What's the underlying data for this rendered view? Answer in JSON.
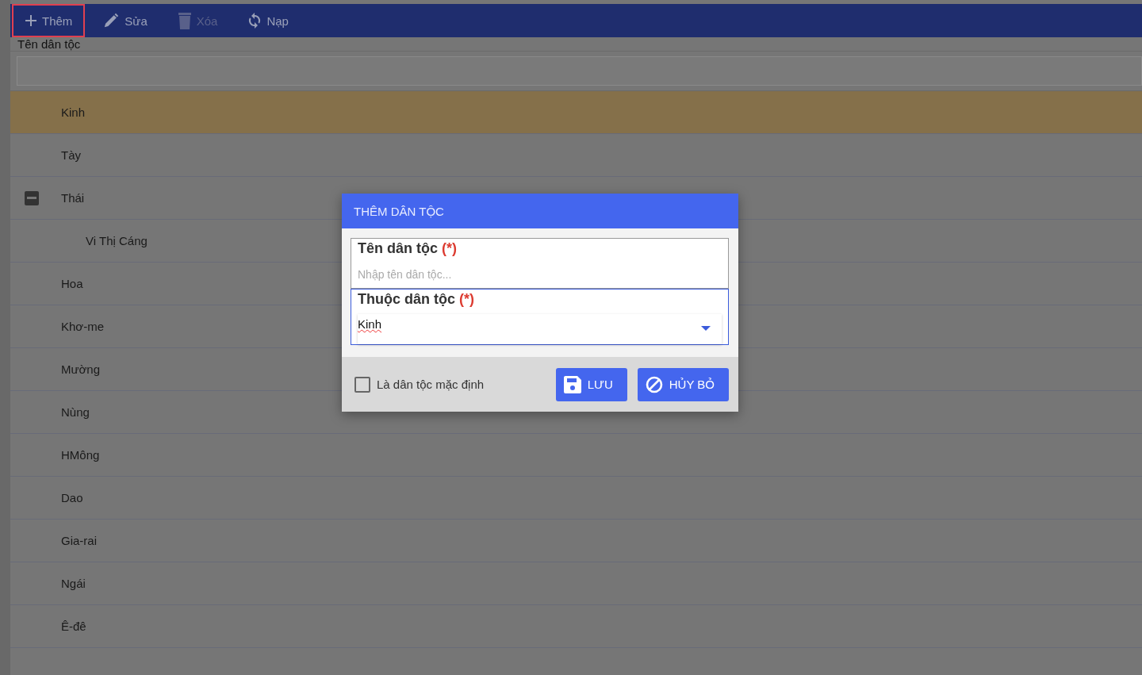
{
  "toolbar": [
    {
      "kind": "add",
      "label": "Thêm",
      "focused": true,
      "disabled": false
    },
    {
      "kind": "edit",
      "label": "Sửa",
      "focused": false,
      "disabled": false
    },
    {
      "kind": "delete",
      "label": "Xóa",
      "focused": false,
      "disabled": true
    },
    {
      "kind": "reload",
      "label": "Nạp",
      "focused": false,
      "disabled": false
    }
  ],
  "column_header": "Tên dân tộc",
  "rows": [
    {
      "name": "Kinh",
      "selected": true
    },
    {
      "name": "Tày",
      "selected": false
    },
    {
      "name": "Thái",
      "selected": false,
      "expanded": true,
      "children": [
        {
          "name": "Vi Thị Cáng",
          "selected": false
        }
      ]
    },
    {
      "name": "Hoa",
      "selected": false
    },
    {
      "name": "Khơ-me",
      "selected": false
    },
    {
      "name": "Mường",
      "selected": false
    },
    {
      "name": "Nùng",
      "selected": false
    },
    {
      "name": "HMông",
      "selected": false
    },
    {
      "name": "Dao",
      "selected": false
    },
    {
      "name": "Gia-rai",
      "selected": false
    },
    {
      "name": "Ngái",
      "selected": false
    },
    {
      "name": "Ê-đê",
      "selected": false
    }
  ],
  "dialog": {
    "title": "THÊM DÂN TỘC",
    "fields": [
      {
        "kind": "text",
        "label": "Tên dân tộc",
        "required": "(*)",
        "placeholder": "Nhập tên dân tộc...",
        "focused": false
      },
      {
        "kind": "select",
        "label": "Thuộc dân tộc",
        "required": "(*)",
        "value": "Kinh",
        "focused": true
      }
    ],
    "default_checkbox": {
      "label": "Là dân tộc mặc định",
      "checked": false
    },
    "buttons": [
      {
        "kind": "save",
        "label": "LƯU"
      },
      {
        "kind": "cancel",
        "label": "HỦY BỎ"
      }
    ]
  }
}
